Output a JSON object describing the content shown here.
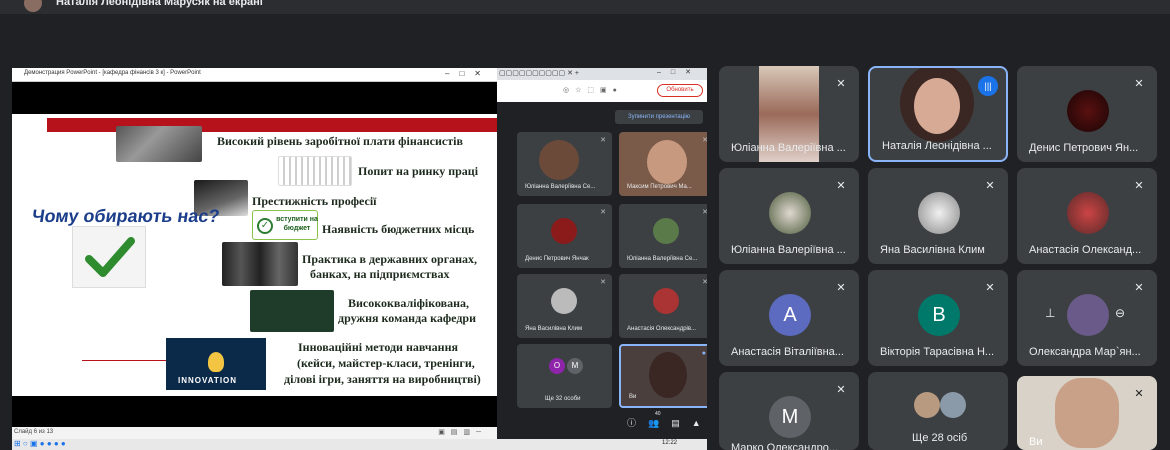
{
  "presenter_bar": {
    "text": "Наталія Леонідівна Марусяк на екрані"
  },
  "ppt": {
    "window_title": "Демонстрация PowerPoint - [кафедра фінансів 3 к] - PowerPoint",
    "status": "Слайд 6 из 13",
    "slide": {
      "title": "Чому обирають нас?",
      "budget_badge": "вступити на бюджет",
      "innovation_label": "INNOVATION",
      "points": [
        "Високий рівень заробітної плати фінансистів",
        "Попит на ринку праці",
        "Престижність професії",
        "Наявність бюджетних місць",
        "Практика в державних органах,",
        "банках, на підприємствах",
        "Висококваліфікована,",
        "дружня команда кафедри",
        "Інноваційні методи навчання",
        "(кейси, майстер-класи, тренінги,",
        "ділові ігри, заняття на виробництві)"
      ]
    }
  },
  "browser": {
    "update_button": "Обновить",
    "stop_presenting": "Зупинити презентацію",
    "tiles": [
      {
        "name": "Юліанна Валеріївна Се..."
      },
      {
        "name": "Максим Петрович Ма..."
      },
      {
        "name": "Денис Петрович Янчак"
      },
      {
        "name": "Юліанна Валеріївна Се..."
      },
      {
        "name": "Яна Василівна Клим"
      },
      {
        "name": "Анастасія Олександрів..."
      },
      {
        "name": "Ще 32 особи",
        "avatars": [
          "О",
          "М"
        ]
      },
      {
        "name": "Ви"
      }
    ],
    "participants_count": "40",
    "clock": "12:22"
  },
  "grid": {
    "tiles": [
      {
        "name": "Юліанна Валеріївна ..."
      },
      {
        "name": "Наталія Леонідівна ..."
      },
      {
        "name": "Денис Петрович Ян..."
      },
      {
        "name": "Юліанна Валеріївна ..."
      },
      {
        "name": "Яна Василівна Клим"
      },
      {
        "name": "Анастасія Олександ..."
      },
      {
        "name": "Анастасія Віталіївна...",
        "initial": "А",
        "color": "#5c6bc0"
      },
      {
        "name": "Вікторія Тарасівна Н...",
        "initial": "В",
        "color": "#00796b"
      },
      {
        "name": "Олександра Мар`ян..."
      },
      {
        "name": "Марко Олександро...",
        "initial": "М",
        "color": "#5f6368"
      },
      {
        "name": "Ще 28 осіб"
      },
      {
        "name": "Ви"
      }
    ]
  },
  "colors": {
    "speaking": "#8ab4f8",
    "tile": "#3c4043",
    "bg": "#202124",
    "slide_red": "#b5121b"
  }
}
